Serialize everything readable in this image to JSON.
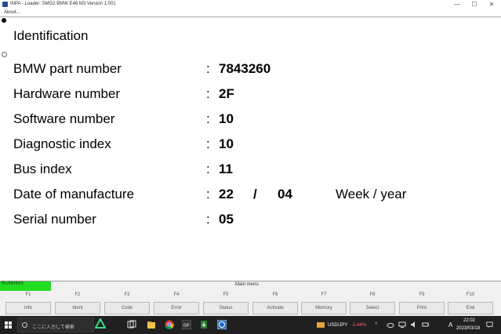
{
  "window": {
    "title": "INPA - Loader:  SMG2 BMW E46 M3 Version 1.001",
    "controls": {
      "minimize": "—",
      "maximize": "☐",
      "close": "✕"
    }
  },
  "menu": {
    "about": "About..."
  },
  "main": {
    "heading": "Identification",
    "rows": [
      {
        "label": "BMW part number",
        "value": "7843260"
      },
      {
        "label": "Hardware number",
        "value": "2F"
      },
      {
        "label": "Software number",
        "value": "10"
      },
      {
        "label": "Diagnostic index",
        "value": "10"
      },
      {
        "label": "Bus index",
        "value": "11"
      },
      {
        "label": "Date of manufacture",
        "value": "22",
        "separator": "/",
        "value2": "04",
        "unit": "Week / year"
      },
      {
        "label": "Serial number",
        "value": "05"
      }
    ],
    "colon": ":"
  },
  "status": {
    "running": "RUNNING",
    "menu_title": "Main menu"
  },
  "fkeys": [
    {
      "key": "F1",
      "label": "Info"
    },
    {
      "key": "F2",
      "label": "Ident"
    },
    {
      "key": "F3",
      "label": "Code"
    },
    {
      "key": "F4",
      "label": "Error"
    },
    {
      "key": "F5",
      "label": "Status"
    },
    {
      "key": "F6",
      "label": "Activate"
    },
    {
      "key": "F7",
      "label": "Memory"
    },
    {
      "key": "F8",
      "label": "Select"
    },
    {
      "key": "F9",
      "label": "Print"
    },
    {
      "key": "F10",
      "label": "End"
    }
  ],
  "taskbar": {
    "search_placeholder": "ここに入力して検索",
    "ticker_symbol": "USD/JPY",
    "ticker_change": "-1.44%",
    "ime": "A",
    "time": "22:02",
    "date": "2023/03/18",
    "ticker_color": "#ff6b6b"
  }
}
